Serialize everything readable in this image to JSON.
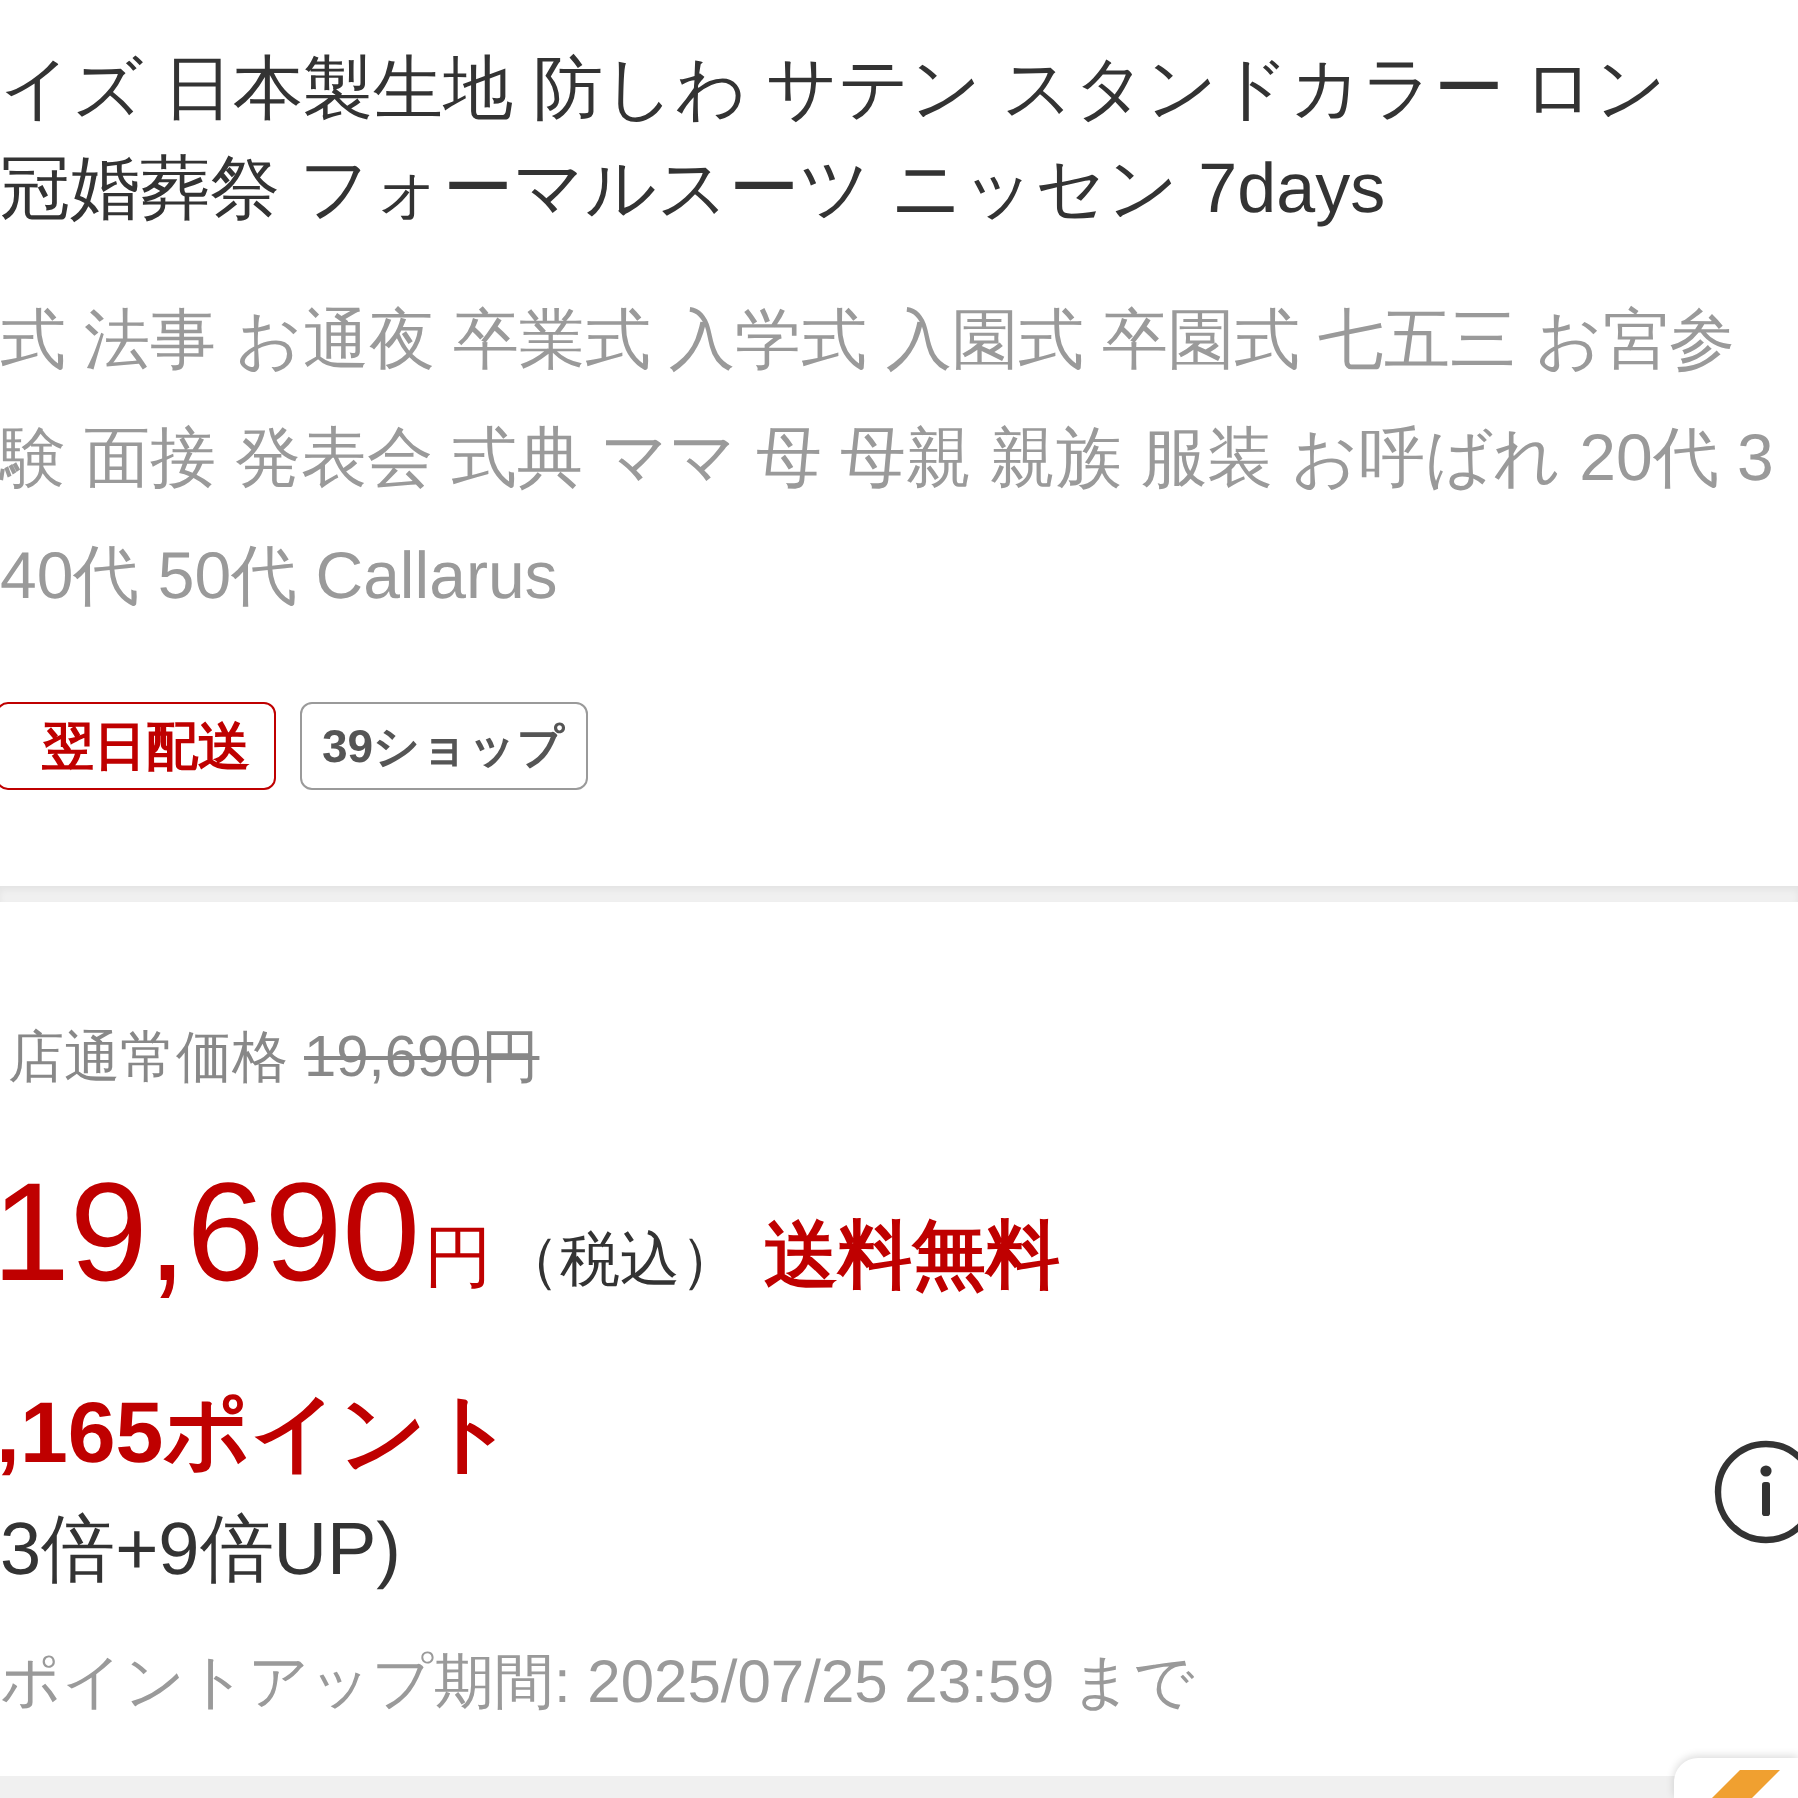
{
  "title_lines": [
    "イズ 日本製生地 防しわ サテン スタンドカラー ロン",
    "冠婚葬祭 フォーマルスーツ ニッセン 7days"
  ],
  "keyword_lines": [
    "式 法事 お通夜 卒業式 入学式 入園式 卒園式 七五三 お宮参",
    "験 面接 発表会 式典 ママ 母 母親 親族 服装 お呼ばれ 20代 3",
    "40代 50代 Callarus"
  ],
  "badges": [
    {
      "kind": "delivery",
      "label": "翌日配送"
    },
    {
      "kind": "shop",
      "label": "39ショップ"
    }
  ],
  "price": {
    "regular_label": "店通常価格",
    "regular_price": "19,690円",
    "amount": "19,690",
    "currency": "円",
    "tax_note": "（税込）",
    "shipping": "送料無料"
  },
  "points": {
    "amount": ",165ポイント",
    "multiplier": "3倍+9倍UP)",
    "period": "ポイントアップ期間: 2025/07/25 23:59 まで"
  }
}
